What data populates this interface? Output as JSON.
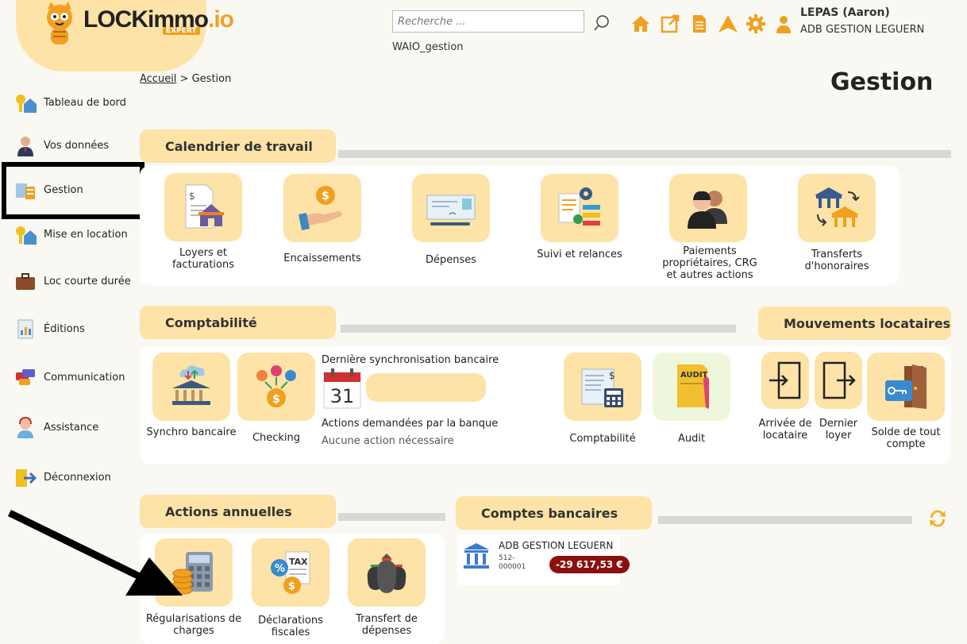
{
  "brand": {
    "name_main": "LOCKimmo",
    "name_suffix": ".io",
    "tag": "EXPERT"
  },
  "search": {
    "placeholder": "Recherche ..."
  },
  "header": {
    "workspace": "WAIO_gestion",
    "user_name": "LEPAS (Aaron)",
    "company": "ADB GESTION LEGUERN"
  },
  "icons": {
    "home": "home-icon",
    "external": "external-link-icon",
    "document": "document-icon",
    "notify": "alert-icon",
    "settings": "gear-icon",
    "user": "user-icon",
    "accent": "#f0a020"
  },
  "sidebar": {
    "items": [
      {
        "label": "Tableau de bord"
      },
      {
        "label": "Vos données"
      },
      {
        "label": "Gestion"
      },
      {
        "label": "Mise en location"
      },
      {
        "label": "Loc courte durée"
      },
      {
        "label": "Éditions"
      },
      {
        "label": "Communication"
      },
      {
        "label": "Assistance"
      },
      {
        "label": "Déconnexion"
      }
    ]
  },
  "breadcrumb": {
    "home": "Accueil",
    "sep": ">",
    "current": "Gestion"
  },
  "page_title": "Gestion",
  "calendrier": {
    "title": "Calendrier de travail",
    "tiles": [
      {
        "label": "Loyers et facturations"
      },
      {
        "label": "Encaissements"
      },
      {
        "label": "Dépenses"
      },
      {
        "label": "Suivi et relances"
      },
      {
        "label": "Paiements propriétaires, CRG et autres actions"
      },
      {
        "label": "Transferts d'honoraires"
      }
    ]
  },
  "comptabilite": {
    "title": "Comptabilité",
    "tiles": [
      {
        "label": "Synchro bancaire"
      },
      {
        "label": "Checking"
      },
      {
        "label": "Comptabilité"
      },
      {
        "label": "Audit"
      }
    ],
    "sync_title": "Dernière synchronisation bancaire",
    "calendar_day": "31",
    "bank_actions_title": "Actions demandées par la banque",
    "bank_actions_status": "Aucune action nécessaire"
  },
  "mouvements": {
    "title": "Mouvements locataires",
    "tiles": [
      {
        "label": "Arrivée de locataire"
      },
      {
        "label": "Dernier loyer"
      },
      {
        "label": "Solde de tout compte"
      }
    ]
  },
  "actions_annuelles": {
    "title": "Actions annuelles",
    "tiles": [
      {
        "label": "Régularisations de charges"
      },
      {
        "label": "Déclarations fiscales"
      },
      {
        "label": "Transfert de dépenses"
      }
    ]
  },
  "comptes": {
    "title": "Comptes bancaires",
    "account_name": "ADB GESTION LEGUERN",
    "account_number": "512-000001",
    "balance": "-29 617,53 €"
  }
}
